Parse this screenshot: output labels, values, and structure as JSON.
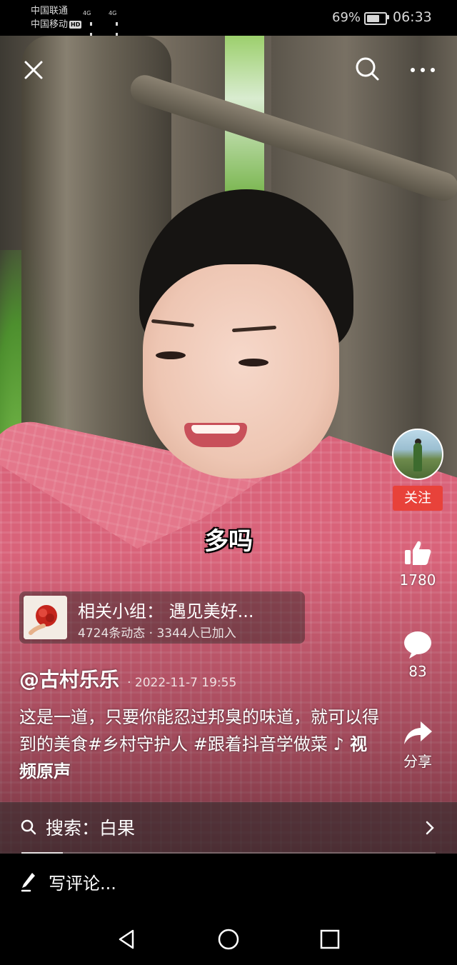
{
  "status_bar": {
    "carrier_1": "中国联通",
    "carrier_2": "中国移动",
    "hd_badge": "HD",
    "signal_1": "4G",
    "signal_2": "4G",
    "battery_percent": "69%",
    "battery_level": 0.69,
    "time": "06:33"
  },
  "top_bar": {
    "close_icon": "close-icon",
    "search_icon": "search-icon",
    "more_icon": "more-icon"
  },
  "video": {
    "subtitle": "多吗"
  },
  "side_actions": {
    "follow_label": "关注",
    "like_count": "1780",
    "comment_count": "83",
    "share_label": "分享"
  },
  "group_card": {
    "title": "相关小组： 遇见美好...",
    "meta": "4724条动态 · 3344人已加入"
  },
  "post": {
    "author": "@古村乐乐",
    "date": "· 2022-11-7 19:55",
    "caption": "这是一道，只要你能忍过邦臭的味道，就可以得到的美食#乡村守护人 #跟着抖音学做菜 ",
    "music": "♪ 视频原声"
  },
  "search_suggestion": {
    "text": "搜索：白果"
  },
  "progress": {
    "played_fraction": 0.1
  },
  "comment_bar": {
    "placeholder": "写评论..."
  },
  "colors": {
    "follow_red": "#e8423a",
    "background": "#000000"
  }
}
